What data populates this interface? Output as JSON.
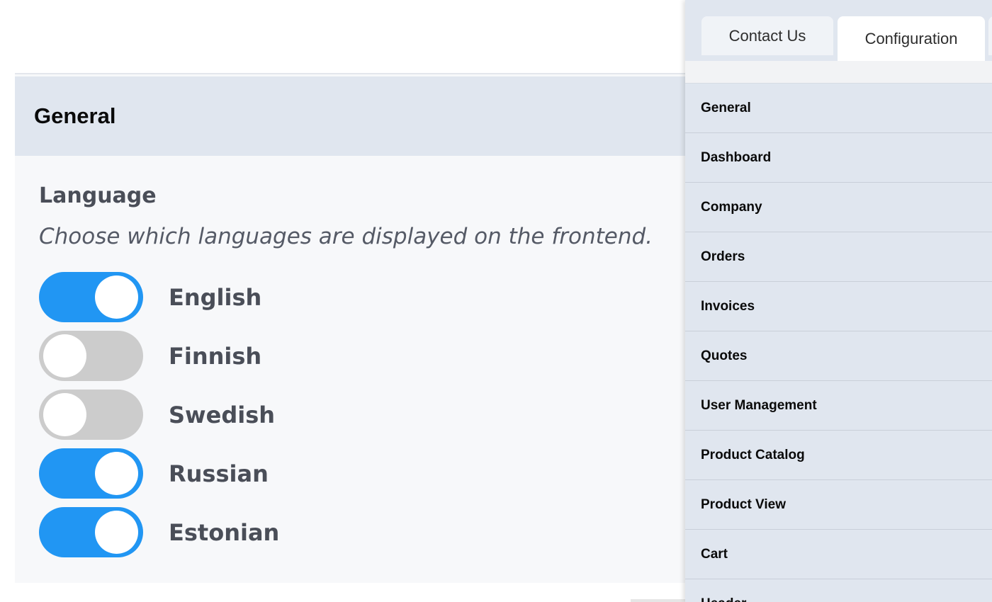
{
  "settings": {
    "title": "General",
    "section_title": "Language",
    "section_description": "Choose which languages are displayed on the frontend.",
    "languages": [
      {
        "label": "English",
        "enabled": true
      },
      {
        "label": "Finnish",
        "enabled": false
      },
      {
        "label": "Swedish",
        "enabled": false
      },
      {
        "label": "Russian",
        "enabled": true
      },
      {
        "label": "Estonian",
        "enabled": true
      }
    ]
  },
  "side_panel": {
    "tabs": [
      {
        "label": "Contact Us",
        "active": false
      },
      {
        "label": "Configuration",
        "active": true
      }
    ],
    "nav_items": [
      {
        "label": "General"
      },
      {
        "label": "Dashboard"
      },
      {
        "label": "Company"
      },
      {
        "label": "Orders"
      },
      {
        "label": "Invoices"
      },
      {
        "label": "Quotes"
      },
      {
        "label": "User Management"
      },
      {
        "label": "Product Catalog"
      },
      {
        "label": "Product View"
      },
      {
        "label": "Cart"
      },
      {
        "label": "Header"
      }
    ]
  },
  "colors": {
    "toggle_on": "#2196f3",
    "toggle_off": "#cccccc",
    "panel_bg": "#e0e6ef",
    "card_bg": "#f7f8fa"
  }
}
